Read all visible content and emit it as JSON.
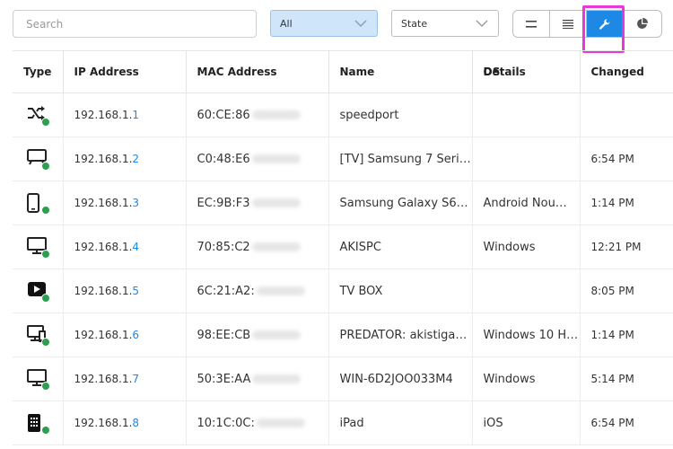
{
  "toolbar": {
    "search_placeholder": "Search",
    "filter_all_label": "All",
    "filter_state_label": "State",
    "view_buttons": [
      "list-compact-icon",
      "list-detailed-icon",
      "wrench-icon",
      "pie-chart-icon"
    ],
    "active_view": "wrench-icon"
  },
  "colors": {
    "accent": "#1e88e5",
    "online_dot": "#2e9e4f",
    "highlight": "#e838d8",
    "filter_bg": "#cfe6fa"
  },
  "table": {
    "headers": {
      "type": "Type",
      "ip": "IP Address",
      "mac": "MAC Address",
      "name": "Name",
      "os": "OS",
      "details": "Details",
      "changed": "Changed"
    },
    "ip_prefix": "192.168.1.",
    "rows": [
      {
        "icon": "shuffle-icon",
        "ip_last": "1",
        "mac": "60:CE:86",
        "name": "speedport",
        "os": "",
        "changed": ""
      },
      {
        "icon": "tv-icon",
        "ip_last": "2",
        "mac": "C0:48:E6",
        "name": "[TV] Samsung 7 Seri…",
        "os": "",
        "changed": "6:54 PM"
      },
      {
        "icon": "phone-icon",
        "ip_last": "3",
        "mac": "EC:9B:F3",
        "name": "Samsung Galaxy S6…",
        "os": "Android Nou…",
        "changed": "1:14 PM"
      },
      {
        "icon": "monitor-icon",
        "ip_last": "4",
        "mac": "70:85:C2",
        "name": "AKISPC",
        "os": "Windows",
        "changed": "12:21 PM"
      },
      {
        "icon": "play-icon",
        "ip_last": "5",
        "mac": "6C:21:A2:",
        "name": "TV BOX",
        "os": "",
        "changed": "8:05 PM"
      },
      {
        "icon": "desktop-tablet-icon",
        "ip_last": "6",
        "mac": "98:EE:CB",
        "name": "PREDATOR: akistiga…",
        "os": "Windows 10 H…",
        "changed": "1:14 PM"
      },
      {
        "icon": "monitor-icon",
        "ip_last": "7",
        "mac": "50:3E:AA",
        "name": "WIN-6D2JOO033M4",
        "os": "Windows",
        "changed": "5:14 PM"
      },
      {
        "icon": "tablet-icon",
        "ip_last": "8",
        "mac": "10:1C:0C:",
        "name": "iPad",
        "os": "iOS",
        "changed": "6:54 PM"
      }
    ]
  }
}
